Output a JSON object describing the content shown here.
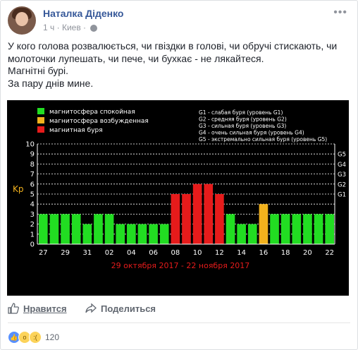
{
  "post": {
    "author": "Наталка Діденко",
    "time": "1 ч",
    "place": "Киев",
    "text_lines": [
      "У кого голова розвалюється, чи гвіздки в голові, чи обручі стискають, чи",
      "молоточки лупешать, чи пече, чи бухкає - не лякайтеся.",
      "Магнітні бурі.",
      "За пару днів мине."
    ]
  },
  "actions": {
    "like_label": "Нравится",
    "share_label": "Поделиться"
  },
  "reactions": {
    "count": "120"
  },
  "icons": [
    "globe-icon",
    "more-options-icon",
    "thumb-up-icon",
    "share-arrow-icon",
    "like-reaction-icon",
    "wow-reaction-icon",
    "sad-reaction-icon"
  ],
  "chart_data": {
    "type": "bar",
    "categories": [
      "27",
      "28",
      "29",
      "30",
      "31",
      "01",
      "02",
      "03",
      "04",
      "05",
      "06",
      "07",
      "08",
      "09",
      "10",
      "11",
      "12",
      "13",
      "14",
      "15",
      "16",
      "17",
      "18",
      "19",
      "20",
      "21",
      "22"
    ],
    "x_tick_labels": [
      "27",
      "29",
      "31",
      "02",
      "04",
      "06",
      "08",
      "10",
      "12",
      "14",
      "16",
      "18",
      "20",
      "22"
    ],
    "values": [
      3,
      3,
      3,
      3,
      2,
      3,
      3,
      2,
      2,
      2,
      2,
      2,
      5,
      5,
      6,
      6,
      5,
      3,
      2,
      2,
      4,
      3,
      3,
      3,
      3,
      3,
      3
    ],
    "colors": [
      "green",
      "green",
      "green",
      "green",
      "green",
      "green",
      "green",
      "green",
      "green",
      "green",
      "green",
      "green",
      "red",
      "red",
      "red",
      "red",
      "red",
      "green",
      "green",
      "green",
      "yellow",
      "green",
      "green",
      "green",
      "green",
      "green",
      "green"
    ],
    "ylabel": "Kp",
    "ylim": [
      0,
      10
    ],
    "y_ticks": [
      "0",
      "1",
      "2",
      "3",
      "4",
      "5",
      "6",
      "7",
      "8",
      "9",
      "10"
    ],
    "right_axis_labels": [
      {
        "label": "G1",
        "level": 5
      },
      {
        "label": "G2",
        "level": 6
      },
      {
        "label": "G3",
        "level": 7
      },
      {
        "label": "G4",
        "level": 8
      },
      {
        "label": "G5",
        "level": 9
      }
    ],
    "date_range": "29 октября 2017 - 22 ноября 2017",
    "legend": [
      {
        "label": "магнитосфера спокойная",
        "color": "#22dd22"
      },
      {
        "label": "магнитосфера возбужденная",
        "color": "#f2b21d"
      },
      {
        "label": "магнитная буря",
        "color": "#e61b1b"
      }
    ],
    "g_legend": [
      "G1 - слабая буря (уровень G1)",
      "G2 - средняя буря (уровень G2)",
      "G3 - сильная буря (уровень G3)",
      "G4 - очень сильная буря (уровень G4)",
      "G5 - экстремально сильная буря (уровень G5)"
    ],
    "grid": true,
    "bar_colors": {
      "green": "#22dd22",
      "yellow": "#f2b21d",
      "red": "#e61b1b"
    }
  }
}
